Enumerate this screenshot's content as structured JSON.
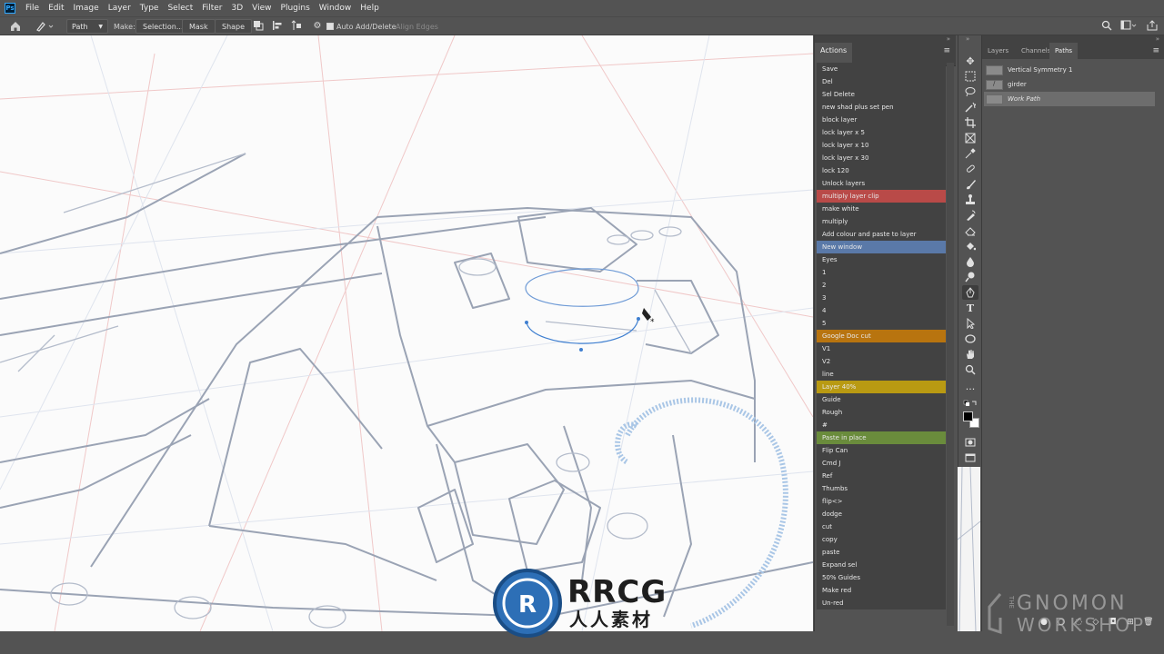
{
  "menubar": {
    "logo": "Ps",
    "items": [
      "File",
      "Edit",
      "Image",
      "Layer",
      "Type",
      "Select",
      "Filter",
      "3D",
      "View",
      "Plugins",
      "Window",
      "Help"
    ]
  },
  "options": {
    "mode_value": "Path",
    "make_label": "Make:",
    "selection_btn": "Selection...",
    "mask_btn": "Mask",
    "shape_btn": "Shape",
    "auto_add_delete": "Auto Add/Delete",
    "auto_add_delete_checked": true,
    "align_edges": "Align Edges"
  },
  "actions": {
    "tab_label": "Actions",
    "items": [
      {
        "label": "Save",
        "color": "#424242"
      },
      {
        "label": "Del",
        "color": "#424242"
      },
      {
        "label": "Sel Delete",
        "color": "#424242"
      },
      {
        "label": "new shad plus set pen",
        "color": "#424242"
      },
      {
        "label": "block layer",
        "color": "#424242"
      },
      {
        "label": "lock layer x 5",
        "color": "#424242"
      },
      {
        "label": "lock layer x 10",
        "color": "#424242"
      },
      {
        "label": "lock layer x 30",
        "color": "#424242"
      },
      {
        "label": "lock 120",
        "color": "#424242"
      },
      {
        "label": "Unlock layers",
        "color": "#424242"
      },
      {
        "label": "multiply layer clip",
        "color": "#b94a48"
      },
      {
        "label": "make white",
        "color": "#424242"
      },
      {
        "label": "multiply",
        "color": "#424242"
      },
      {
        "label": "Add colour and paste to layer",
        "color": "#424242"
      },
      {
        "label": "New window",
        "color": "#5a79a8"
      },
      {
        "label": "Eyes",
        "color": "#424242"
      },
      {
        "label": "1",
        "color": "#424242"
      },
      {
        "label": "2",
        "color": "#424242"
      },
      {
        "label": "3",
        "color": "#424242"
      },
      {
        "label": "4",
        "color": "#424242"
      },
      {
        "label": "5",
        "color": "#424242"
      },
      {
        "label": "Google Doc cut",
        "color": "#b8740f"
      },
      {
        "label": "V1",
        "color": "#424242"
      },
      {
        "label": "V2",
        "color": "#424242"
      },
      {
        "label": "line",
        "color": "#424242"
      },
      {
        "label": "Layer 40%",
        "color": "#b99a12"
      },
      {
        "label": "Guide",
        "color": "#424242"
      },
      {
        "label": "Rough",
        "color": "#424242"
      },
      {
        "label": "#",
        "color": "#424242"
      },
      {
        "label": "Paste in place",
        "color": "#6a8c3c"
      },
      {
        "label": "Flip Can",
        "color": "#424242"
      },
      {
        "label": "Cmd J",
        "color": "#424242"
      },
      {
        "label": "Ref",
        "color": "#424242"
      },
      {
        "label": "Thumbs",
        "color": "#424242"
      },
      {
        "label": "flip<>",
        "color": "#424242"
      },
      {
        "label": "dodge",
        "color": "#424242"
      },
      {
        "label": "cut",
        "color": "#424242"
      },
      {
        "label": "copy",
        "color": "#424242"
      },
      {
        "label": "paste",
        "color": "#424242"
      },
      {
        "label": "Expand sel",
        "color": "#424242"
      },
      {
        "label": "50% Guides",
        "color": "#424242"
      },
      {
        "label": "Make red",
        "color": "#424242"
      },
      {
        "label": "Un-red",
        "color": "#424242"
      }
    ]
  },
  "right_panel": {
    "tabs": [
      "Layers",
      "Channels",
      "Paths"
    ],
    "active_tab": "Paths",
    "paths": [
      {
        "name": "Vertical Symmetry 1",
        "selected": false
      },
      {
        "name": "girder",
        "selected": false
      },
      {
        "name": "Work Path",
        "selected": true
      }
    ]
  },
  "watermark": {
    "rrcg": "RRCG",
    "rrcg_sub": "人人素材",
    "gnomon_the": "THE",
    "gnomon_top": "GNOMON",
    "gnomon_bottom": "WORKSHOP"
  },
  "colors": {
    "ui_bg": "#535353",
    "panel_dark": "#424242",
    "canvas_bg": "#fbfbfb",
    "path_blue": "#3f7fd0"
  }
}
